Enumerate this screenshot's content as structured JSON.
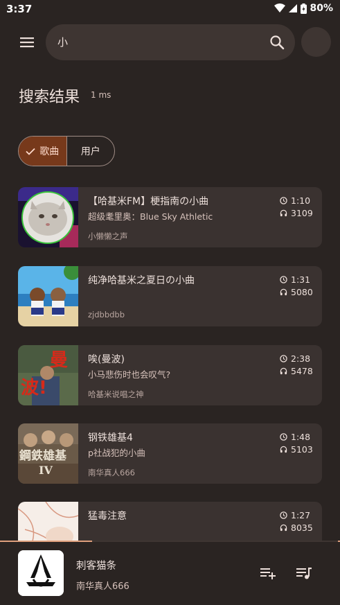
{
  "status_bar": {
    "time": "3:37",
    "battery": "80%"
  },
  "search": {
    "query": "小"
  },
  "results": {
    "title": "搜索结果",
    "elapsed": "1 ms"
  },
  "filters": {
    "songs_label": "歌曲",
    "users_label": "用户"
  },
  "songs": [
    {
      "title": "【哈基米FM】梗指南の小曲",
      "subtitle": "超级耄里奥：Blue Sky Athletic",
      "artist": "小懒懒之声",
      "duration": "1:10",
      "plays": "3109"
    },
    {
      "title": "纯净哈基米之夏日の小曲",
      "subtitle": "",
      "artist": "zjdbbdbb",
      "duration": "1:31",
      "plays": "5080"
    },
    {
      "title": "唉(曼波)",
      "subtitle": "小马悲伤时也会叹气?",
      "artist": "哈基米说唱之神",
      "duration": "2:38",
      "plays": "5478",
      "cover_text_1": "曼",
      "cover_text_2": "波!"
    },
    {
      "title": "钢铁雄基4",
      "subtitle": "p社战犯的小曲",
      "artist": "南华真人666",
      "duration": "1:48",
      "plays": "5103",
      "cover_text_1": "鋼鉄雄基",
      "cover_text_2": "IV"
    },
    {
      "title": "猛毒注意",
      "subtitle": "",
      "artist": "",
      "duration": "1:27",
      "plays": "8035"
    }
  ],
  "player": {
    "title": "刺客猫条",
    "artist": "南华真人666",
    "progress_fraction": 0.27
  },
  "colors": {
    "background": "#2a2422",
    "card": "#3a3230",
    "accent": "#77391b",
    "accent_text": "#ffdbcc",
    "progress": "#e0a07d"
  }
}
